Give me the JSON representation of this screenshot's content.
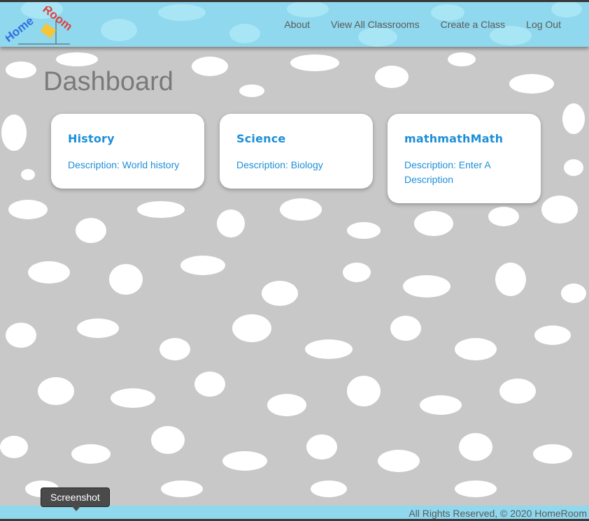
{
  "app": {
    "logo_text_home": "Home",
    "logo_text_room": "Room"
  },
  "nav": {
    "links": [
      {
        "label": "About"
      },
      {
        "label": "View All Classrooms"
      },
      {
        "label": "Create a Class"
      },
      {
        "label": "Log Out"
      }
    ]
  },
  "page": {
    "title": "Dashboard"
  },
  "classes": [
    {
      "title": "History",
      "description": "Description: World history"
    },
    {
      "title": "Science",
      "description": "Description: Biology"
    },
    {
      "title": "mathmathMath",
      "description": "Description: Enter A Description"
    }
  ],
  "footer": {
    "text": "All Rights Reserved, © 2020 HomeRoom"
  },
  "tooltip": {
    "text": "Screenshot"
  },
  "colors": {
    "navbar": "#8fd8ee",
    "background": "#c8c8c8",
    "accent": "#1d8fd8"
  }
}
